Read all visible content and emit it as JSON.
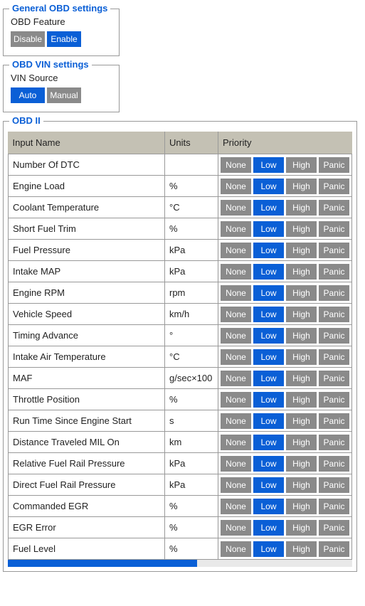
{
  "general": {
    "legend": "General OBD settings",
    "featureLabel": "OBD Feature",
    "disable": "Disable",
    "enable": "Enable",
    "selected": "Enable"
  },
  "vin": {
    "legend": "OBD VIN settings",
    "sourceLabel": "VIN Source",
    "auto": "Auto",
    "manual": "Manual",
    "selected": "Auto"
  },
  "obd2": {
    "legend": "OBD II",
    "headers": {
      "name": "Input Name",
      "units": "Units",
      "priority": "Priority"
    },
    "priorityLabels": {
      "none": "None",
      "low": "Low",
      "high": "High",
      "panic": "Panic"
    },
    "rows": [
      {
        "name": "Number Of DTC",
        "units": "",
        "priority": "Low"
      },
      {
        "name": "Engine Load",
        "units": "%",
        "priority": "Low"
      },
      {
        "name": "Coolant Temperature",
        "units": "°C",
        "priority": "Low"
      },
      {
        "name": "Short Fuel Trim",
        "units": "%",
        "priority": "Low"
      },
      {
        "name": "Fuel Pressure",
        "units": "kPa",
        "priority": "Low"
      },
      {
        "name": "Intake MAP",
        "units": "kPa",
        "priority": "Low"
      },
      {
        "name": "Engine RPM",
        "units": "rpm",
        "priority": "Low"
      },
      {
        "name": "Vehicle Speed",
        "units": "km/h",
        "priority": "Low"
      },
      {
        "name": "Timing Advance",
        "units": "°",
        "priority": "Low"
      },
      {
        "name": "Intake Air Temperature",
        "units": "°C",
        "priority": "Low"
      },
      {
        "name": "MAF",
        "units": "g/sec×100",
        "priority": "Low"
      },
      {
        "name": "Throttle Position",
        "units": "%",
        "priority": "Low"
      },
      {
        "name": "Run Time Since Engine Start",
        "units": "s",
        "priority": "Low"
      },
      {
        "name": "Distance Traveled MIL On",
        "units": "km",
        "priority": "Low"
      },
      {
        "name": "Relative Fuel Rail Pressure",
        "units": "kPa",
        "priority": "Low"
      },
      {
        "name": "Direct Fuel Rail Pressure",
        "units": "kPa",
        "priority": "Low"
      },
      {
        "name": "Commanded EGR",
        "units": "%",
        "priority": "Low"
      },
      {
        "name": "EGR Error",
        "units": "%",
        "priority": "Low"
      },
      {
        "name": "Fuel Level",
        "units": "%",
        "priority": "Low"
      }
    ]
  }
}
